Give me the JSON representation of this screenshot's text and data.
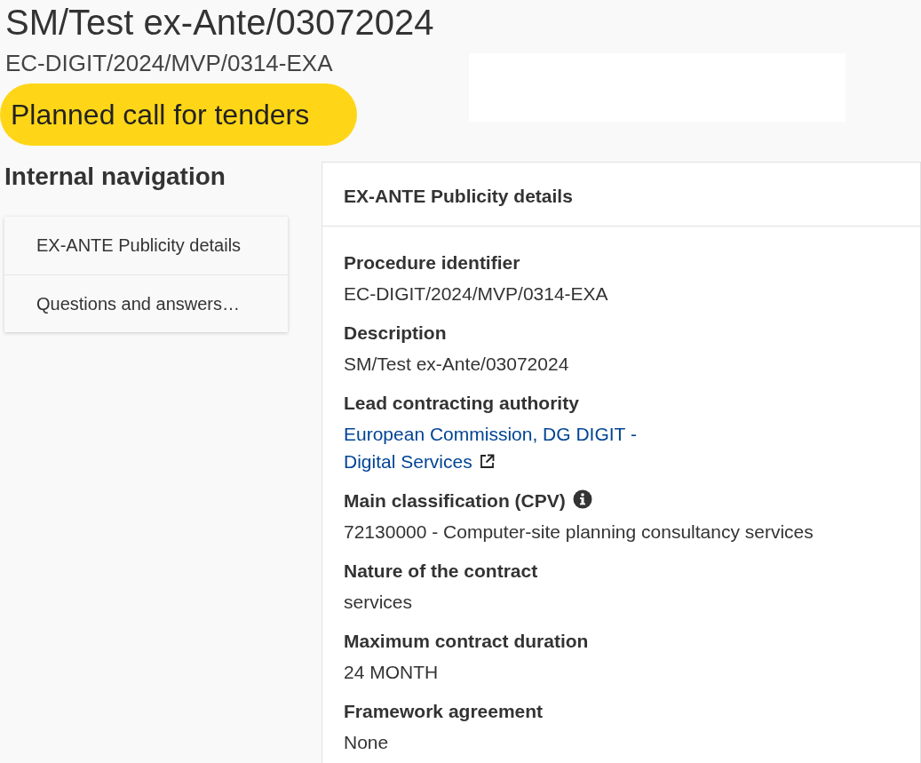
{
  "header": {
    "title": "SM/Test ex-Ante/03072024",
    "reference": "EC-DIGIT/2024/MVP/0314-EXA",
    "status": "Planned call for tenders"
  },
  "navigation": {
    "title": "Internal navigation",
    "items": [
      {
        "label": "EX-ANTE Publicity details"
      },
      {
        "label": "Questions and answers…"
      }
    ]
  },
  "panel": {
    "title": "EX-ANTE Publicity details",
    "fields": [
      {
        "label": "Procedure identifier",
        "value": "EC-DIGIT/2024/MVP/0314-EXA",
        "kind": "text",
        "info": false
      },
      {
        "label": "Description",
        "value": "SM/Test ex-Ante/03072024",
        "kind": "text",
        "info": false
      },
      {
        "label": "Lead contracting authority",
        "value": "European Commission, DG DIGIT - Digital Services",
        "kind": "link",
        "info": false
      },
      {
        "label": "Main classification (CPV)",
        "value": "72130000 - Computer-site planning consultancy services",
        "kind": "text",
        "info": true
      },
      {
        "label": "Nature of the contract",
        "value": "services",
        "kind": "text",
        "info": false
      },
      {
        "label": "Maximum contract duration",
        "value": "24 MONTH",
        "kind": "text",
        "info": false
      },
      {
        "label": "Framework agreement",
        "value": "None",
        "kind": "text",
        "info": false
      }
    ]
  }
}
